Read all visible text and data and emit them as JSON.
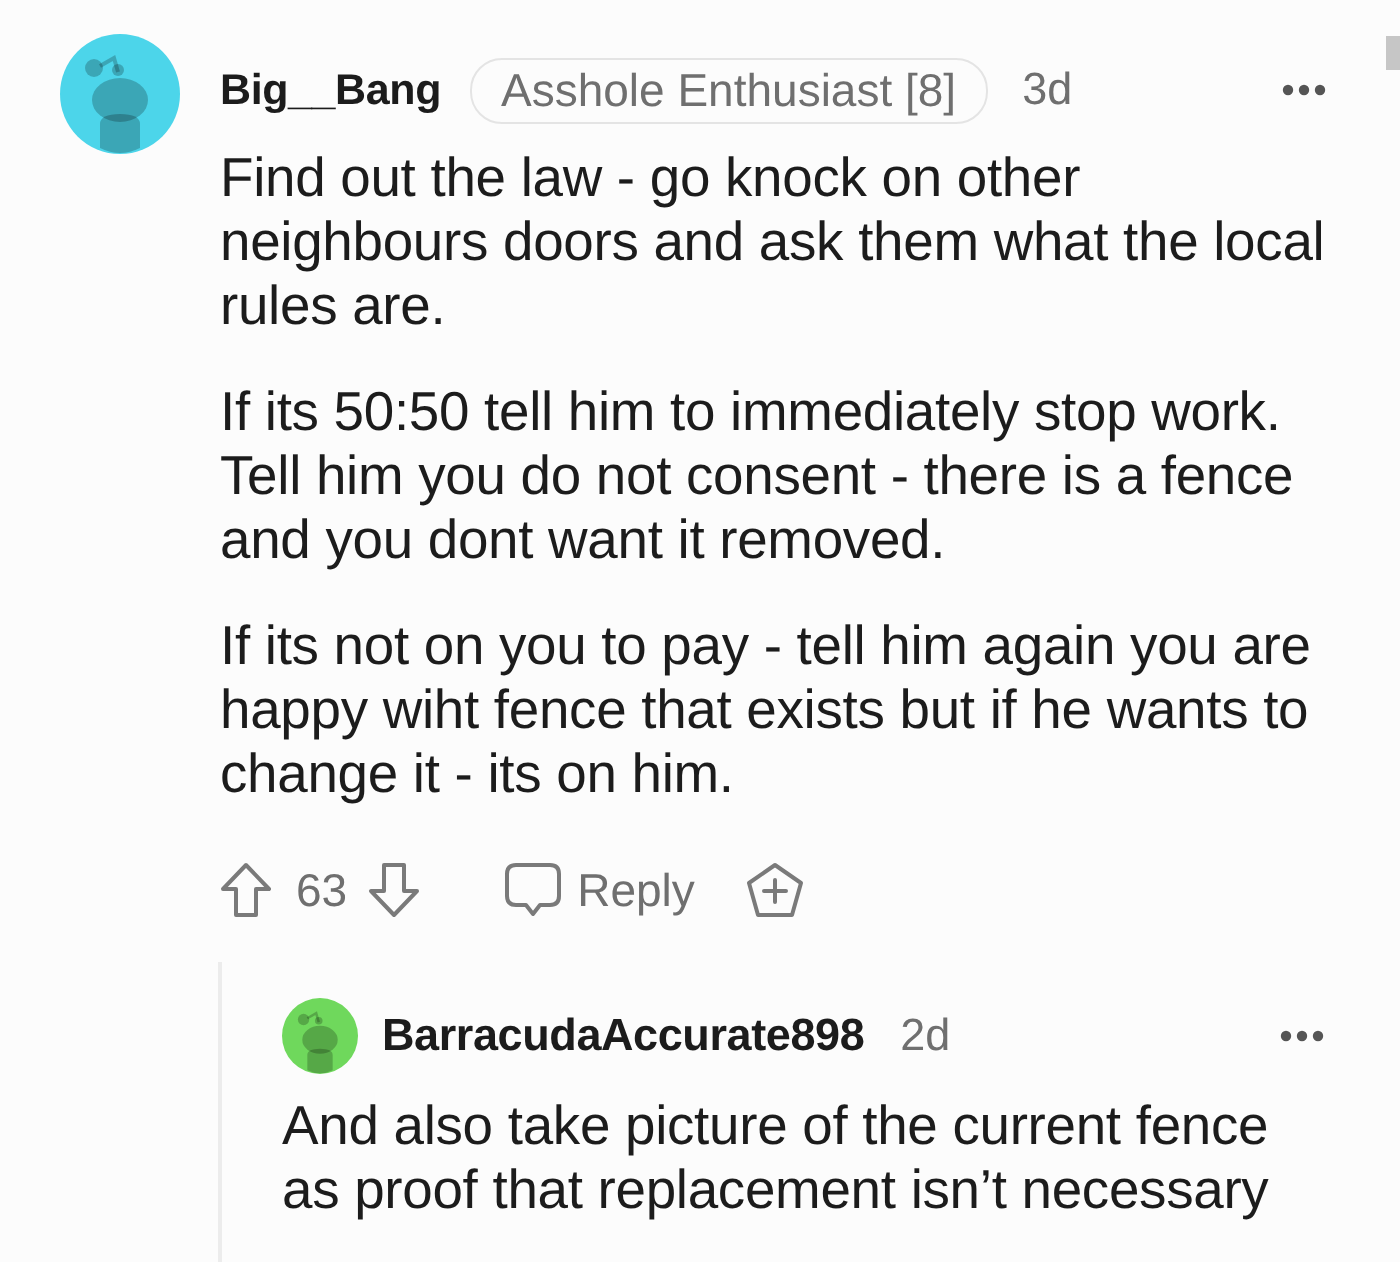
{
  "comments": [
    {
      "author": "Big__Bang",
      "flair": "Asshole Enthusiast [8]",
      "age": "3d",
      "color": "#4cd5ea",
      "paragraphs": [
        "Find out the law - go knock on other neighbours doors and ask them what the local rules are.",
        "If its 50:50 tell him to immediately stop work. Tell him you do not consent - there is a fence and you dont want it removed.",
        "If its not on you to pay - tell him again you are happy wiht fence that exists but if he wants to change it - its on him."
      ],
      "score": "63",
      "reply_label": "Reply",
      "children": [
        {
          "author": "BarracudaAccurate898",
          "age": "2d",
          "color": "#6fd85c",
          "paragraphs": [
            "And also take picture of the current fence as proof that replacement isn’t necessary"
          ]
        }
      ]
    }
  ]
}
